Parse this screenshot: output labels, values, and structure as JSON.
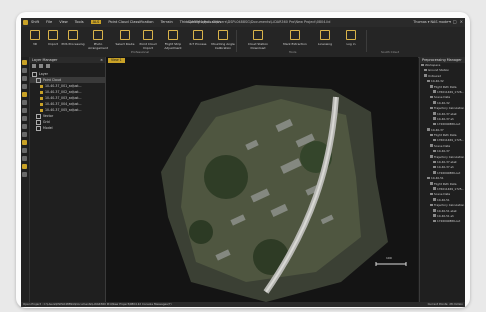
{
  "window": {
    "title": "LiDAR360 Pro - C:\\Users\\DSPL0488SG\\Documents\\LiDAR360 Pro\\New Project\\0804.lid",
    "user": "Thomas ▾  NAS mode ▾"
  },
  "menu": [
    "Shift",
    "File",
    "View",
    "Tools",
    "ALS",
    "Point Cloud Classification",
    "Terrain",
    "Third-party application"
  ],
  "menu_active": "ALS",
  "ribbon": {
    "buttons": [
      "3D",
      "Import",
      "POS Processing",
      "Photo Arrangement",
      "Select Route",
      "Point Cloud Import",
      "Flight Strip Adjustment",
      "R-T Process",
      "Mounting Angle Calibration",
      "Cloud Station Download",
      "Mark Extraction",
      "Licensing",
      "Log in"
    ],
    "groups": [
      "Professional",
      "Tools",
      "South Cloud"
    ]
  },
  "layer_manager": {
    "title": "Layer Manager",
    "tree": [
      {
        "label": "Layer",
        "level": 0,
        "type": "folder"
      },
      {
        "label": "Point Cloud",
        "level": 1,
        "type": "folder",
        "selected": true
      },
      {
        "label": "10-40-37_001_adjust...",
        "level": 2,
        "type": "check"
      },
      {
        "label": "10-40-37_002_adjust...",
        "level": 2,
        "type": "check"
      },
      {
        "label": "10-40-37_003_adjust...",
        "level": 2,
        "type": "check"
      },
      {
        "label": "10-40-37_004_adjust...",
        "level": 2,
        "type": "check"
      },
      {
        "label": "10-40-37_005_adjust...",
        "level": 2,
        "type": "check"
      },
      {
        "label": "Vector",
        "level": 1,
        "type": "folder"
      },
      {
        "label": "Grid",
        "level": 1,
        "type": "folder"
      },
      {
        "label": "Model",
        "level": 1,
        "type": "folder"
      }
    ]
  },
  "viewer": {
    "tab": "View 1",
    "scale_label": "100"
  },
  "workspace": {
    "title": "Preprocessing Manager",
    "rows": [
      {
        "label": "Workspace",
        "level": 0
      },
      {
        "label": "Ground Station",
        "level": 1
      },
      {
        "label": "Untoured",
        "level": 1
      },
      {
        "label": "10-40-32",
        "level": 2
      },
      {
        "label": "Flight Path Data",
        "level": 3
      },
      {
        "label": "176011469_1726...",
        "level": 4
      },
      {
        "label": "Scene Data",
        "level": 3
      },
      {
        "label": "10-40-32",
        "level": 4
      },
      {
        "label": "Trajectory Calculation",
        "level": 3
      },
      {
        "label": "10-40-37.sbet",
        "level": 4
      },
      {
        "label": "10-40-37.sh",
        "level": 4
      },
      {
        "label": "1726040889.out",
        "level": 4
      },
      {
        "label": "10-40-37",
        "level": 2
      },
      {
        "label": "Flight Path Data",
        "level": 3
      },
      {
        "label": "176011469_1725...",
        "level": 4
      },
      {
        "label": "Scene Data",
        "level": 3
      },
      {
        "label": "10-40-37",
        "level": 4
      },
      {
        "label": "Trajectory Calculation",
        "level": 3
      },
      {
        "label": "10-40-37.sbet",
        "level": 4
      },
      {
        "label": "10-40-37.sh",
        "level": 4
      },
      {
        "label": "1726040889.out",
        "level": 4
      },
      {
        "label": "10-40-51",
        "level": 2
      },
      {
        "label": "Flight Path Data",
        "level": 3
      },
      {
        "label": "176011469_1725...",
        "level": 4
      },
      {
        "label": "Scene Data",
        "level": 3
      },
      {
        "label": "10-40-51",
        "level": 4
      },
      {
        "label": "Trajectory Calculation",
        "level": 3
      },
      {
        "label": "10-40-51.sbet",
        "level": 4
      },
      {
        "label": "10-40-51.sh",
        "level": 4
      },
      {
        "label": "1726040889.out",
        "level": 4
      }
    ]
  },
  "status": {
    "left": "Open Project : C:\\Users\\DSPL0488SG\\Documents\\LiDAR360 Pro\\New Project\\0804.lid  Console Messages(7)",
    "right": "Current Points: 28 million"
  },
  "colors": {
    "accent": "#c9a227",
    "background": "#1c1c1c"
  }
}
